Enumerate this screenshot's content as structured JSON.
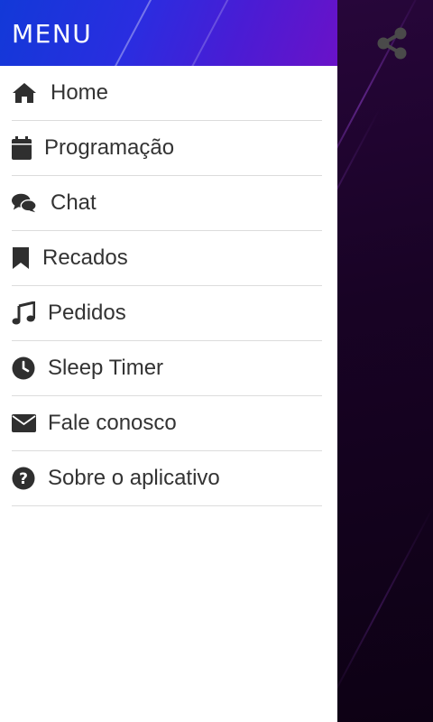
{
  "drawer": {
    "title": "MENU",
    "header_colors": [
      "#1239d8",
      "#6a12c8"
    ]
  },
  "menu": {
    "items": [
      {
        "label": "Home",
        "icon": "home-icon"
      },
      {
        "label": "Programação",
        "icon": "calendar-icon"
      },
      {
        "label": "Chat",
        "icon": "chat-icon"
      },
      {
        "label": "Recados",
        "icon": "bookmark-icon"
      },
      {
        "label": "Pedidos",
        "icon": "music-note-icon"
      },
      {
        "label": "Sleep Timer",
        "icon": "clock-icon"
      },
      {
        "label": "Fale conosco",
        "icon": "envelope-icon"
      },
      {
        "label": "Sobre o aplicativo",
        "icon": "question-circle-icon"
      }
    ]
  },
  "toolbar": {
    "share_icon": "share-icon"
  },
  "colors": {
    "icon": "#2f2f2f",
    "text": "#333333",
    "divider": "#dcdcdc",
    "background": "#14021c"
  }
}
